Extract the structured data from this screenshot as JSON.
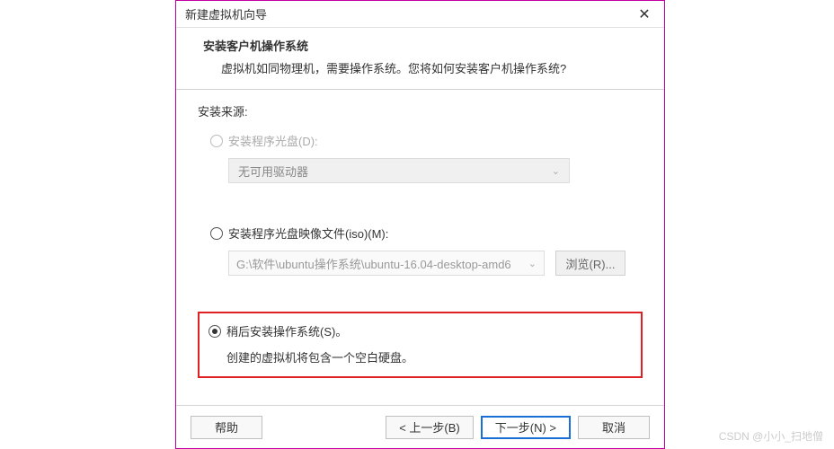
{
  "titlebar": {
    "title": "新建虚拟机向导"
  },
  "header": {
    "title": "安装客户机操作系统",
    "subtitle": "虚拟机如同物理机，需要操作系统。您将如何安装客户机操作系统?"
  },
  "source_label": "安装来源:",
  "option_disc": {
    "label": "安装程序光盘(D):",
    "select_text": "无可用驱动器"
  },
  "option_iso": {
    "label": "安装程序光盘映像文件(iso)(M):",
    "path": "G:\\软件\\ubuntu操作系统\\ubuntu-16.04-desktop-amd6",
    "browse": "浏览(R)..."
  },
  "option_later": {
    "label": "稍后安装操作系统(S)。",
    "desc": "创建的虚拟机将包含一个空白硬盘。"
  },
  "footer": {
    "help": "帮助",
    "back": "< 上一步(B)",
    "next": "下一步(N) >",
    "cancel": "取消"
  },
  "watermark": "CSDN @小小_扫地僧"
}
